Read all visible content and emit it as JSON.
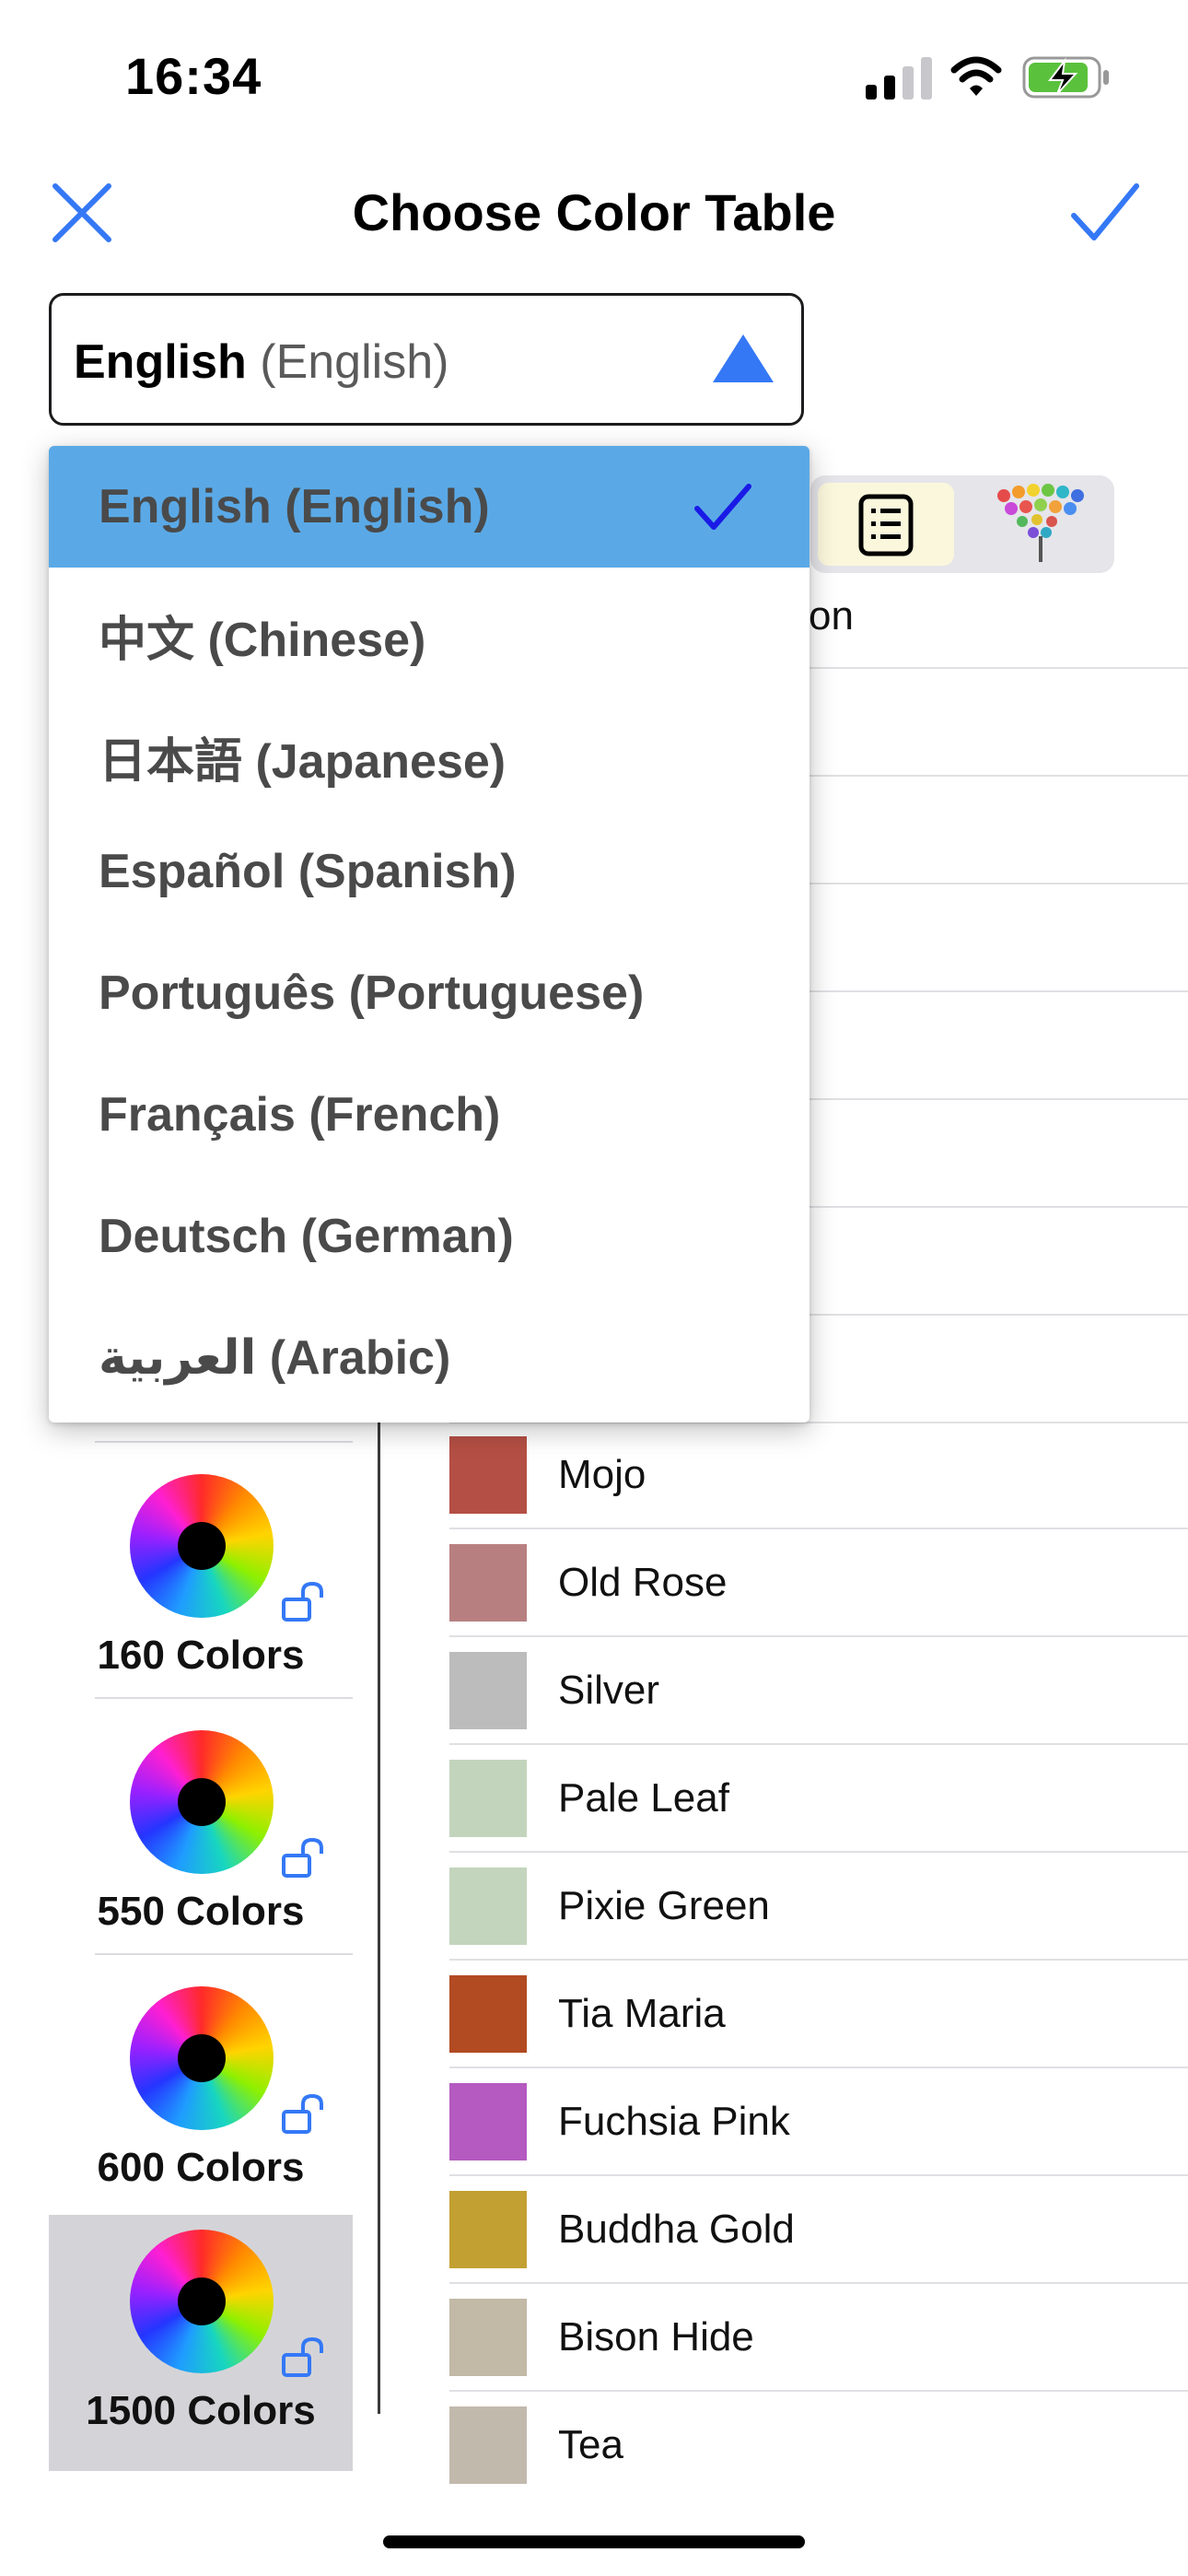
{
  "status": {
    "time": "16:34"
  },
  "nav": {
    "title": "Choose Color Table"
  },
  "language": {
    "selected_native": "English",
    "selected_english": "(English)",
    "options": [
      {
        "label": "English (English)",
        "selected": true
      },
      {
        "label": "中文 (Chinese)",
        "selected": false
      },
      {
        "label": "日本語 (Japanese)",
        "selected": false
      },
      {
        "label": "Español (Spanish)",
        "selected": false
      },
      {
        "label": "Português (Portuguese)",
        "selected": false
      },
      {
        "label": "Français (French)",
        "selected": false
      },
      {
        "label": "Deutsch (German)",
        "selected": false
      },
      {
        "label": "العربية (Arabic)",
        "selected": false
      }
    ]
  },
  "view_toggle": {
    "list_icon": "list-icon",
    "tree_icon": "color-tree-icon",
    "partial_label": "on"
  },
  "tables": [
    {
      "label": "160 Colors",
      "selected": false
    },
    {
      "label": "550 Colors",
      "selected": false
    },
    {
      "label": "600 Colors",
      "selected": false
    },
    {
      "label": "1500 Colors",
      "selected": true
    }
  ],
  "colors": [
    {
      "name": "Mojo",
      "hex": "#b44f45"
    },
    {
      "name": "Old Rose",
      "hex": "#b87f81"
    },
    {
      "name": "Silver",
      "hex": "#bcbcbc"
    },
    {
      "name": "Pale Leaf",
      "hex": "#c3d4bc"
    },
    {
      "name": "Pixie Green",
      "hex": "#c3d5bd"
    },
    {
      "name": "Tia Maria",
      "hex": "#b24a22"
    },
    {
      "name": "Fuchsia Pink",
      "hex": "#b45ac0"
    },
    {
      "name": "Buddha Gold",
      "hex": "#c2a032"
    },
    {
      "name": "Bison Hide",
      "hex": "#c2b9a6"
    },
    {
      "name": "Tea",
      "hex": "#c2b9ad"
    }
  ],
  "theme": {
    "accent": "#3478f6",
    "selected_option": "#5aa9e6"
  }
}
